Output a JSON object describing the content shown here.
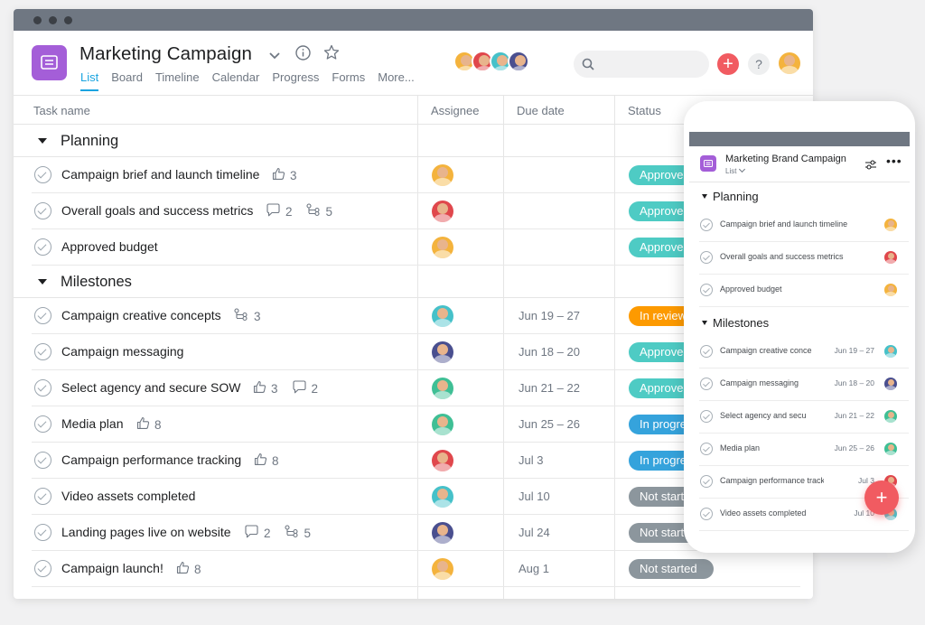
{
  "project": {
    "title": "Marketing Campaign",
    "tabs": [
      {
        "label": "List",
        "active": true
      },
      {
        "label": "Board"
      },
      {
        "label": "Timeline"
      },
      {
        "label": "Calendar"
      },
      {
        "label": "Progress"
      },
      {
        "label": "Forms"
      },
      {
        "label": "More..."
      }
    ]
  },
  "header": {
    "add_label": "+",
    "help_label": "?",
    "accent_color": "#f15b61"
  },
  "columns": {
    "task": "Task name",
    "assignee": "Assignee",
    "due": "Due date",
    "status": "Status"
  },
  "sections": [
    {
      "title": "Planning",
      "tasks": [
        {
          "name": "Campaign brief and launch timeline",
          "likes": "3",
          "avatar": "yellow",
          "due": "",
          "status": "Approved",
          "status_color": "green"
        },
        {
          "name": "Overall goals and success metrics",
          "comments": "2",
          "subtasks": "5",
          "avatar": "red",
          "due": "",
          "status": "Approved",
          "status_color": "green"
        },
        {
          "name": "Approved budget",
          "avatar": "yellow",
          "due": "",
          "status": "Approved",
          "status_color": "green"
        }
      ]
    },
    {
      "title": "Milestones",
      "tasks": [
        {
          "name": "Campaign creative concepts",
          "subtasks": "3",
          "avatar": "teal",
          "due": "Jun 19 – 27",
          "status": "In review",
          "status_color": "orange"
        },
        {
          "name": "Campaign messaging",
          "avatar": "navy",
          "due": "Jun 18 – 20",
          "status": "Approved",
          "status_color": "green"
        },
        {
          "name": "Select agency and secure SOW",
          "likes": "3",
          "comments": "2",
          "avatar": "green",
          "due": "Jun 21 – 22",
          "status": "Approved",
          "status_color": "green"
        },
        {
          "name": "Media plan",
          "likes": "8",
          "avatar": "green",
          "due": "Jun 25 – 26",
          "status": "In progress",
          "status_color": "blue"
        },
        {
          "name": "Campaign performance tracking",
          "likes": "8",
          "avatar": "red",
          "due": "Jul 3",
          "status": "In progress",
          "status_color": "blue"
        },
        {
          "name": "Video assets completed",
          "avatar": "teal",
          "due": "Jul 10",
          "status": "Not started",
          "status_color": "gray"
        },
        {
          "name": "Landing pages live on website",
          "comments": "2",
          "subtasks": "5",
          "avatar": "navy",
          "due": "Jul 24",
          "status": "Not started",
          "status_color": "gray"
        },
        {
          "name": "Campaign launch!",
          "likes": "8",
          "avatar": "yellow",
          "due": "Aug 1",
          "status": "Not started",
          "status_color": "gray"
        }
      ]
    }
  ],
  "mobile": {
    "title": "Marketing Brand Campaign",
    "view": "List",
    "more": "•••",
    "fab": "+",
    "sections": [
      {
        "title": "Planning",
        "tasks": [
          {
            "name": "Campaign brief and launch timeline",
            "due": "",
            "avatar": "yellow"
          },
          {
            "name": "Overall goals and success metrics",
            "due": "",
            "avatar": "red"
          },
          {
            "name": "Approved budget",
            "due": "",
            "avatar": "yellow"
          }
        ]
      },
      {
        "title": "Milestones",
        "tasks": [
          {
            "name": "Campaign creative conce",
            "due": "Jun 19 – 27",
            "avatar": "teal"
          },
          {
            "name": "Campaign messaging",
            "due": "Jun 18 – 20",
            "avatar": "navy"
          },
          {
            "name": "Select agency and secu",
            "due": "Jun 21 – 22",
            "avatar": "green"
          },
          {
            "name": "Media plan",
            "due": "Jun 25 – 26",
            "avatar": "green"
          },
          {
            "name": "Campaign performance track",
            "due": "Jul 3",
            "avatar": "red"
          },
          {
            "name": "Video assets completed",
            "due": "Jul 10",
            "avatar": "teal"
          }
        ]
      }
    ]
  }
}
